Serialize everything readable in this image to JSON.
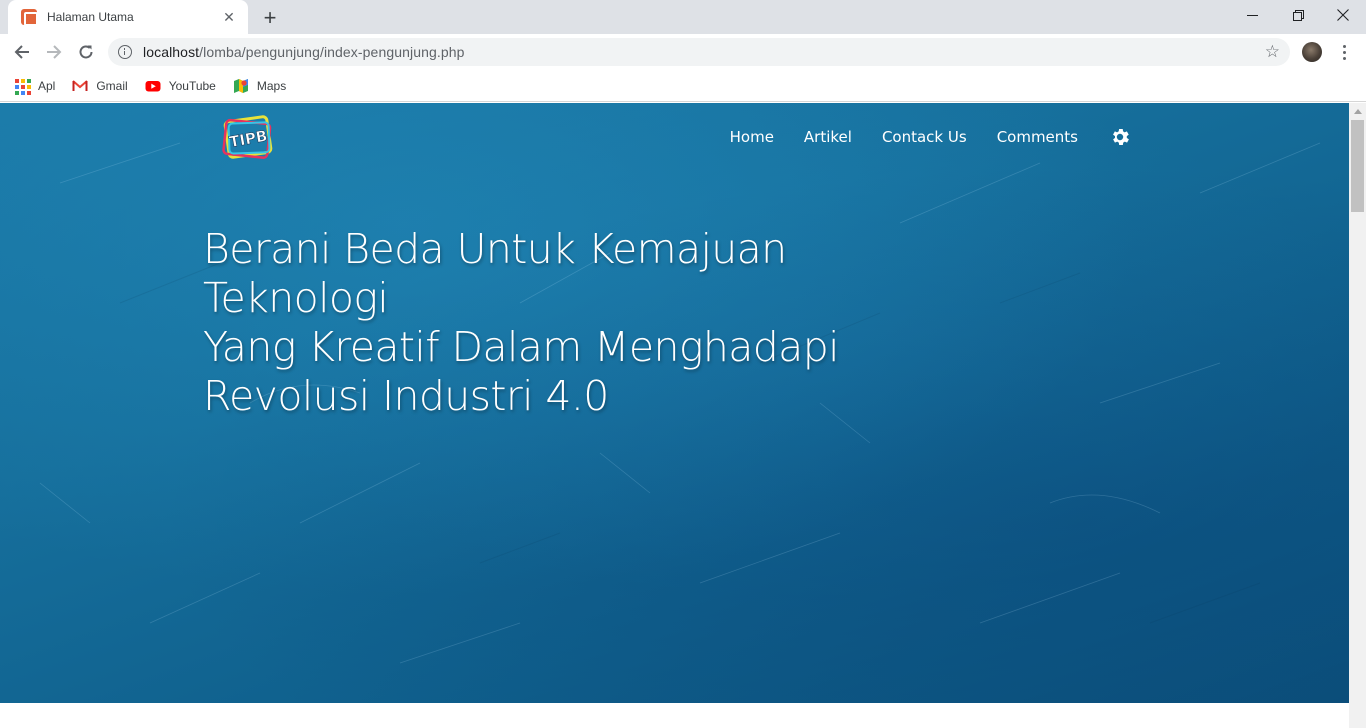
{
  "browser": {
    "tab": {
      "title": "Halaman Utama",
      "close_label": "✕"
    },
    "new_tab_label": "+",
    "window_controls": {
      "minimize": "—",
      "restore": "❐",
      "close": "✕"
    },
    "address": {
      "host": "localhost",
      "path": "/lomba/pengunjung/index-pengunjung.php"
    },
    "bookmarks": [
      {
        "label": "Apl",
        "icon": "apps-grid-icon"
      },
      {
        "label": "Gmail",
        "icon": "gmail-icon"
      },
      {
        "label": "YouTube",
        "icon": "youtube-icon"
      },
      {
        "label": "Maps",
        "icon": "maps-icon"
      }
    ]
  },
  "site": {
    "logo_text": "TIPB",
    "nav": [
      {
        "label": "Home"
      },
      {
        "label": "Artikel"
      },
      {
        "label": "Contack Us"
      },
      {
        "label": "Comments"
      }
    ],
    "settings_icon": "gear-icon",
    "hero": {
      "line1": "Berani Beda Untuk Kemajuan Teknologi",
      "line2": "Yang Kreatif Dalam Menghadapi",
      "line3": "Revolusi Industri 4.0"
    }
  },
  "colors": {
    "page_background": "#166f9c",
    "chrome_tabstrip": "#dee1e6",
    "omnibox": "#f1f3f4"
  }
}
